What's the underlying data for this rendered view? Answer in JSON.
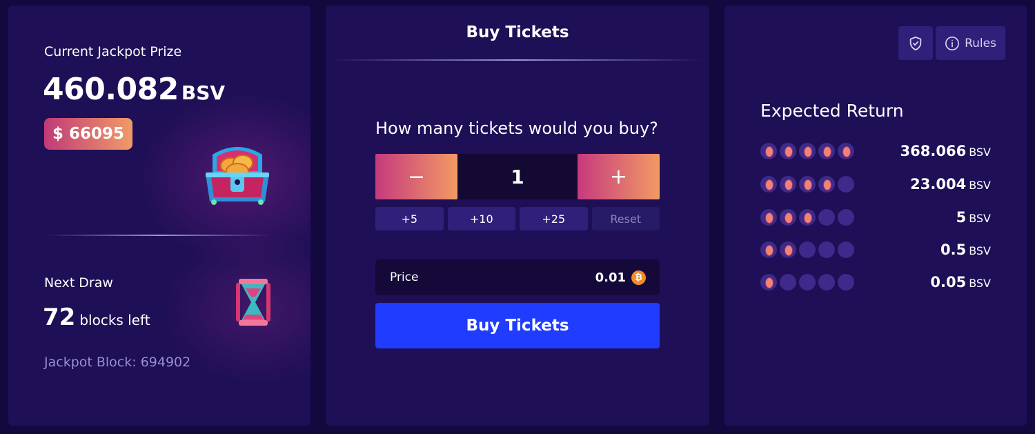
{
  "jackpot": {
    "label": "Current Jackpot Prize",
    "amount": "460.082",
    "unit": "BSV",
    "usd": "$ 66095"
  },
  "next_draw": {
    "label": "Next Draw",
    "blocks": "72",
    "blocks_text": "blocks left",
    "jackpot_block": "Jackpot Block: 694902"
  },
  "buy": {
    "title": "Buy Tickets",
    "question": "How many tickets would you buy?",
    "minus": "−",
    "plus": "+",
    "quantity": "1",
    "quick": [
      "+5",
      "+10",
      "+25"
    ],
    "reset": "Reset",
    "price_label": "Price",
    "price_value": "0.01",
    "coin_symbol": "₿",
    "button": "Buy Tickets"
  },
  "header": {
    "shield_icon": "shield-check-icon",
    "rules_icon": "info-icon",
    "rules_label": "Rules"
  },
  "expected": {
    "title": "Expected Return",
    "rows": [
      {
        "matched": 5,
        "value": "368.066",
        "unit": "BSV"
      },
      {
        "matched": 4,
        "value": "23.004",
        "unit": "BSV"
      },
      {
        "matched": 3,
        "value": "5",
        "unit": "BSV"
      },
      {
        "matched": 2,
        "value": "0.5",
        "unit": "BSV"
      },
      {
        "matched": 1,
        "value": "0.05",
        "unit": "BSV"
      }
    ]
  },
  "colors": {
    "background": "#13093f",
    "panel": "#1e0f56",
    "accent_gradient_start": "#c63a7e",
    "accent_gradient_end": "#f29a64",
    "buy_button": "#1f3cff",
    "coin": "#f08c2c"
  }
}
